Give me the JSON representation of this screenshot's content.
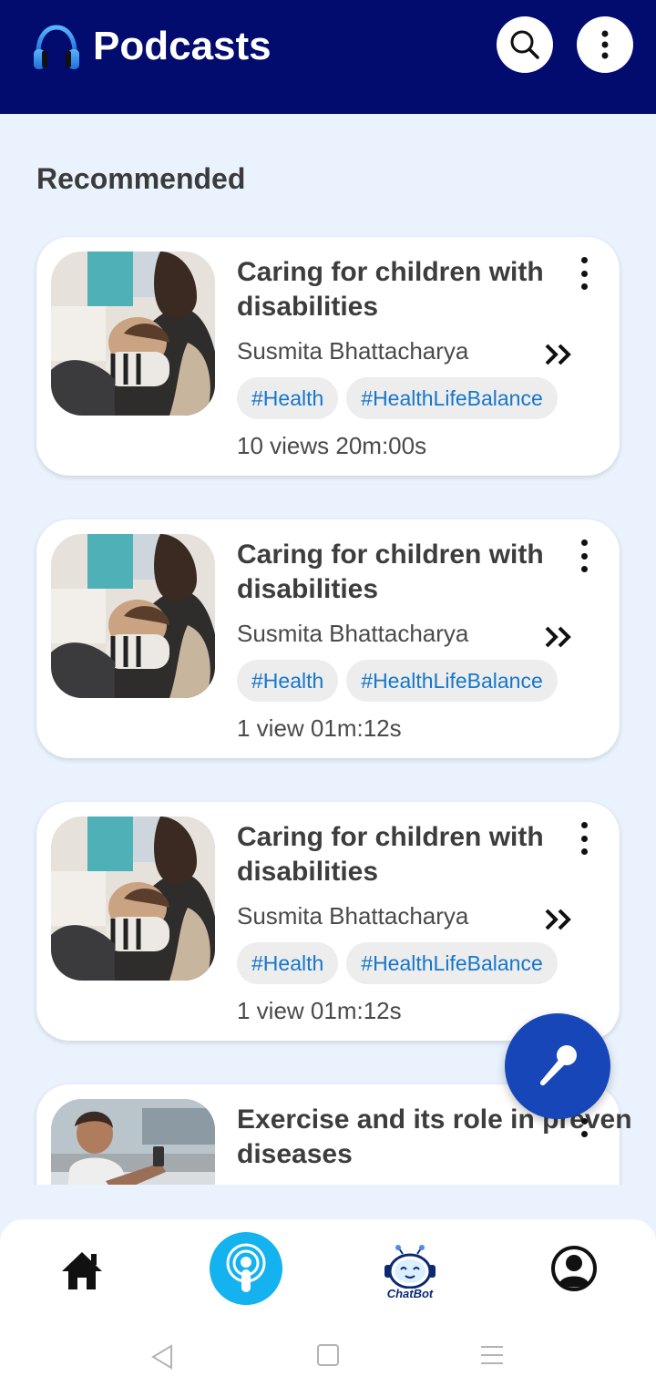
{
  "app_bar": {
    "title": "Podcasts",
    "icon": "headphones-icon",
    "actions": [
      "search-icon",
      "more-vertical-icon"
    ],
    "background": "#020b6e"
  },
  "section": {
    "title": "Recommended"
  },
  "podcasts": [
    {
      "title": "Caring for children with disabilities",
      "author": "Susmita Bhattacharya",
      "tags": [
        "#Health",
        "#HealthLifeBalance"
      ],
      "meta": "10 views 20m:00s"
    },
    {
      "title": "Caring for children with disabilities",
      "author": "Susmita Bhattacharya",
      "tags": [
        "#Health",
        "#HealthLifeBalance"
      ],
      "meta": "1 view 01m:12s"
    },
    {
      "title": "Caring for children with disabilities",
      "author": "Susmita Bhattacharya",
      "tags": [
        "#Health",
        "#HealthLifeBalance"
      ],
      "meta": "1 view 01m:12s"
    },
    {
      "title": "Exercise and its role in preven diseases"
    }
  ],
  "fab": {
    "icon": "microphone-icon",
    "color": "#1746b8"
  },
  "bottom_nav": {
    "items": [
      {
        "icon": "home-icon"
      },
      {
        "icon": "podcast-icon",
        "active": true
      },
      {
        "icon": "chatbot-icon",
        "label": "ChatBot"
      },
      {
        "icon": "profile-icon"
      }
    ],
    "active_color": "#14b2ee"
  },
  "system_nav": [
    "back-icon",
    "recents-icon",
    "menu-icon"
  ]
}
